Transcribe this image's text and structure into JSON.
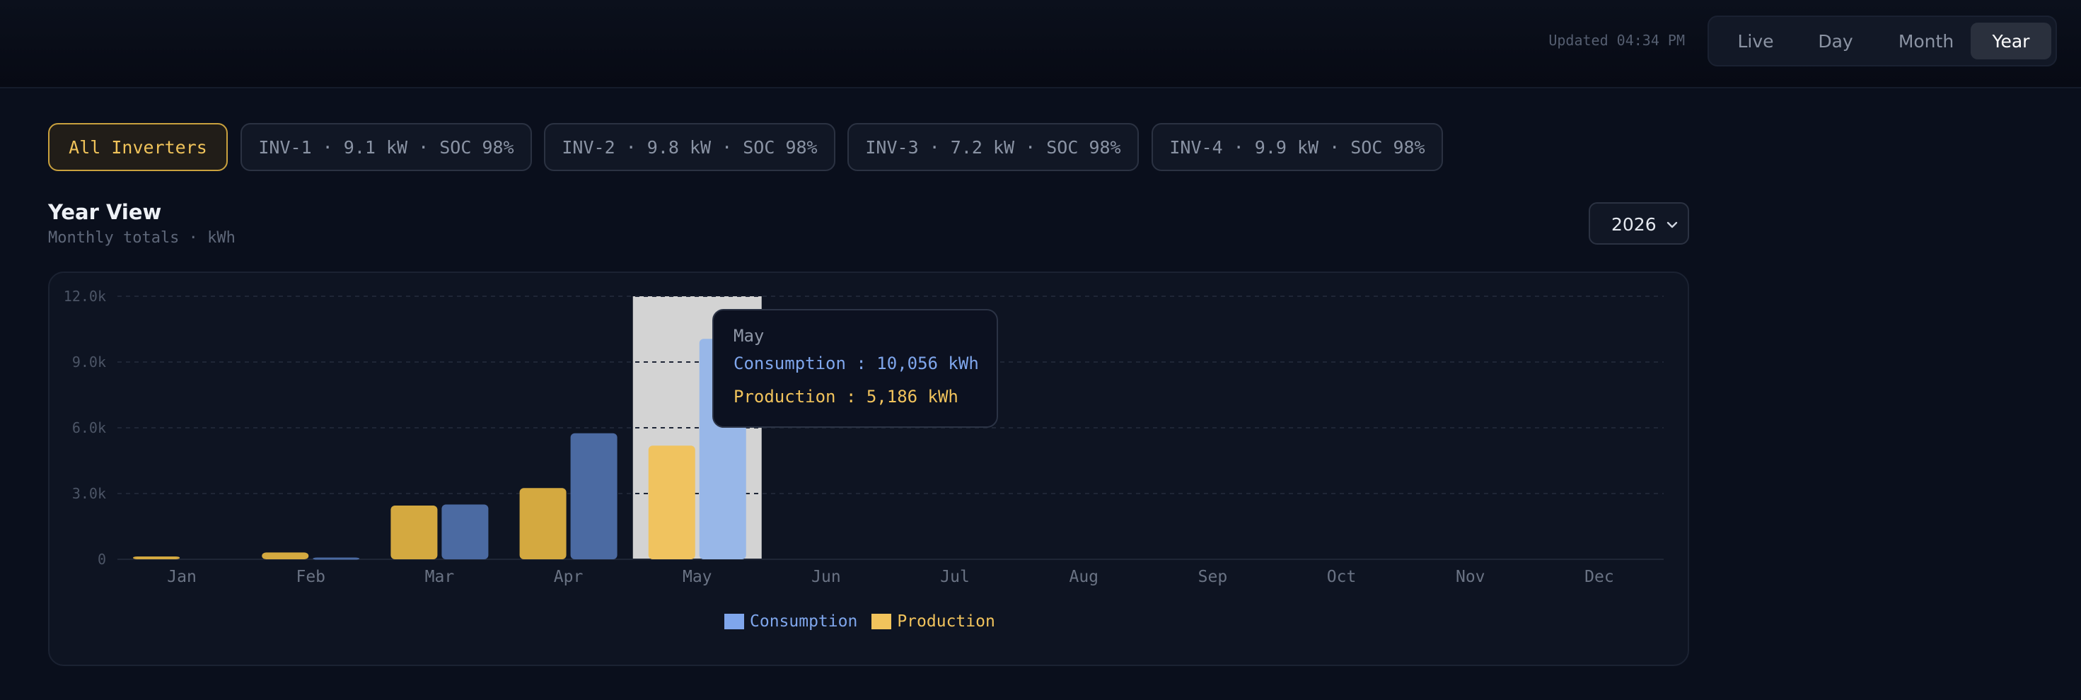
{
  "header": {
    "updated": "Updated 04:34 PM",
    "views": [
      "Live",
      "Day",
      "Month",
      "Year"
    ],
    "active_view": "Year"
  },
  "inverters": [
    {
      "label": "All Inverters"
    },
    {
      "label": "INV-1 · 9.1 kW · SOC 98%"
    },
    {
      "label": "INV-2 · 9.8 kW · SOC 98%"
    },
    {
      "label": "INV-3 · 7.2 kW · SOC 98%"
    },
    {
      "label": "INV-4 · 9.9 kW · SOC 98%"
    }
  ],
  "section": {
    "title": "Year View",
    "subtitle": "Monthly totals · kWh",
    "year": "2026"
  },
  "colors": {
    "production": "#f1c35c",
    "consumption": "#7fa6ec"
  },
  "tooltip": {
    "month": "May",
    "consumption": "Consumption : 10,056 kWh",
    "production": "Production : 5,186 kWh"
  },
  "chart_data": {
    "type": "bar",
    "categories": [
      "Jan",
      "Feb",
      "Mar",
      "Apr",
      "May",
      "Jun",
      "Jul",
      "Aug",
      "Sep",
      "Oct",
      "Nov",
      "Dec"
    ],
    "series": [
      {
        "name": "Production",
        "values": [
          130,
          310,
          2450,
          3250,
          5186,
          0,
          0,
          0,
          0,
          0,
          0,
          0
        ]
      },
      {
        "name": "Consumption",
        "values": [
          0,
          80,
          2500,
          5750,
          10056,
          0,
          0,
          0,
          0,
          0,
          0,
          0
        ]
      }
    ],
    "yticks": [
      "0",
      "3.0k",
      "6.0k",
      "9.0k",
      "12.0k"
    ],
    "ylim": [
      0,
      12000
    ],
    "grid": true,
    "highlight": "May",
    "legend_position": "bottom-center"
  }
}
